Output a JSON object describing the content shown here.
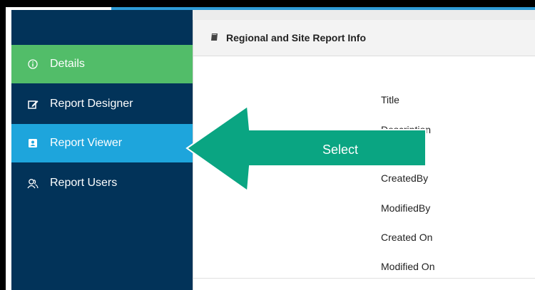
{
  "sidebar": {
    "items": [
      {
        "label": "Details",
        "icon": "info-circle-icon"
      },
      {
        "label": "Report Designer",
        "icon": "edit-icon"
      },
      {
        "label": "Report Viewer",
        "icon": "contact-book-icon"
      },
      {
        "label": "Report Users",
        "icon": "users-icon"
      }
    ]
  },
  "panel": {
    "title": "Regional and Site Report Info",
    "title_icon": "book-icon",
    "fields": [
      "Title",
      "Description",
      "CreatedBy",
      "ModifiedBy",
      "Created On",
      "Modified On"
    ]
  },
  "callout": {
    "label": "Select",
    "color": "#0aa582"
  },
  "colors": {
    "sidebar_bg": "#023359",
    "active_green": "#52bd69",
    "active_blue": "#1ea5dc",
    "header_blue": "#2e9bd6"
  }
}
